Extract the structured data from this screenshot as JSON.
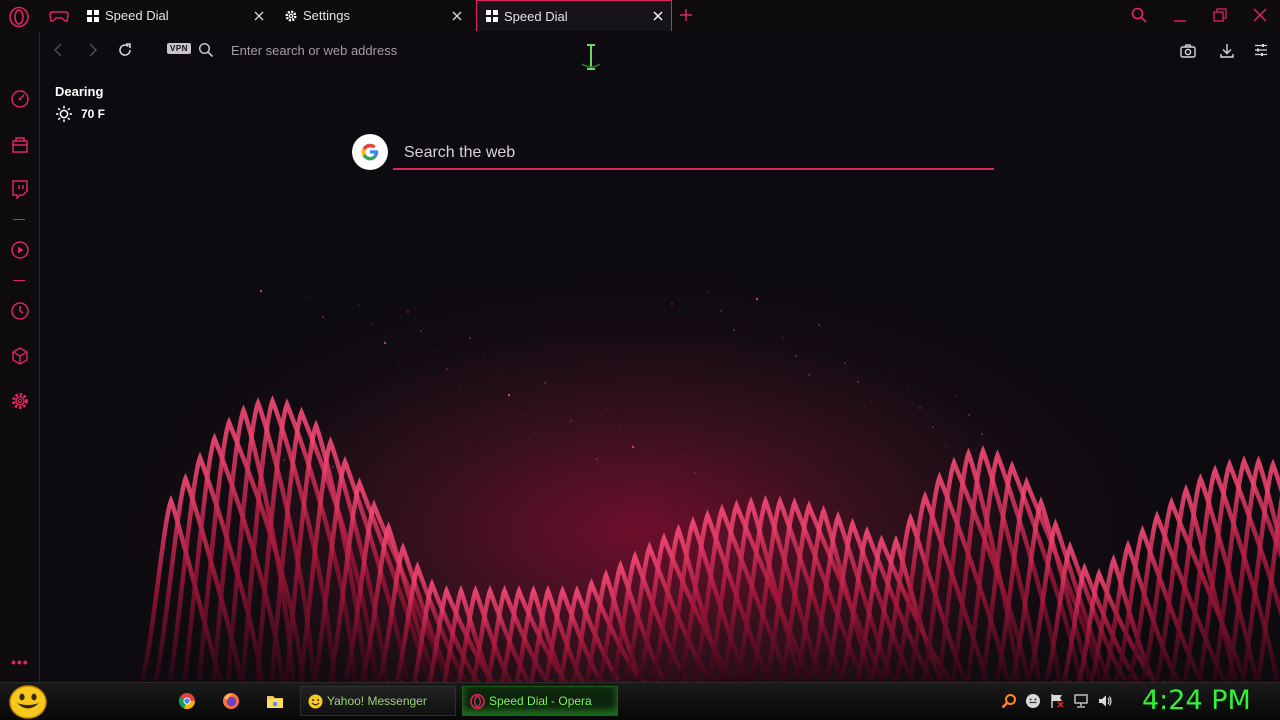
{
  "window": {
    "tabs": [
      {
        "label": "Speed Dial",
        "icon": "speed-dial-icon",
        "active": false
      },
      {
        "label": "Settings",
        "icon": "gear-icon",
        "active": false
      },
      {
        "label": "Speed Dial",
        "icon": "speed-dial-icon",
        "active": true
      }
    ],
    "controls": [
      "search-tabs-icon",
      "minimize-icon",
      "restore-icon",
      "close-icon"
    ]
  },
  "sidebar": {
    "items": [
      "speed-dial-icon",
      "shopping-icon",
      "twitch-icon",
      "player-icon",
      "history-icon",
      "extensions-icon",
      "settings-icon"
    ],
    "more_label": "•••"
  },
  "addressbar": {
    "vpn_label": "VPN",
    "placeholder": "Enter search or web address",
    "value": ""
  },
  "weather": {
    "city": "Dearing",
    "temperature": "70 F",
    "icon": "sun-icon"
  },
  "search": {
    "engine_icon": "google-icon",
    "placeholder": "Search the web"
  },
  "taskbar": {
    "pinned": [
      "chrome-icon",
      "firefox-icon",
      "file-explorer-icon"
    ],
    "buttons": [
      {
        "label": "Yahoo! Messenger",
        "icon": "yahoo-messenger-icon"
      },
      {
        "label": "Speed Dial - Opera",
        "icon": "opera-icon",
        "active": true
      }
    ],
    "tray": [
      "search-icon",
      "messenger-icon",
      "flag-icon",
      "network-icon",
      "volume-icon"
    ],
    "clock": "4:24 PM"
  },
  "colors": {
    "accent": "#e0245e",
    "background": "#0e0b10",
    "clock": "#33f23a"
  }
}
